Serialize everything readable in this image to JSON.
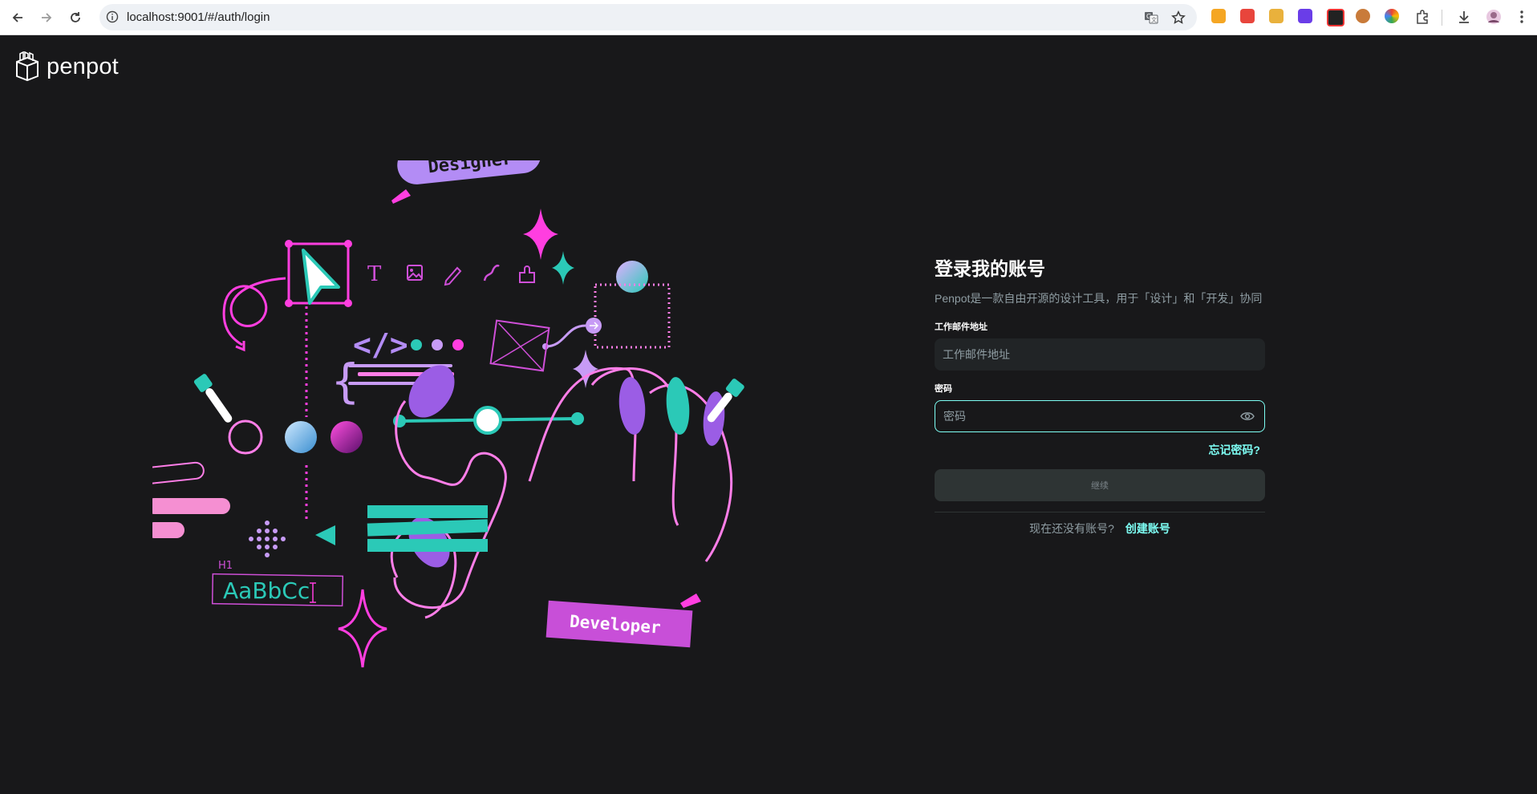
{
  "browser": {
    "url": "localhost:9001/#/auth/login",
    "icons": [
      "back-icon",
      "forward-icon",
      "reload-icon",
      "site-info-icon",
      "translate-icon",
      "bookmark-star-icon",
      "downloads-icon",
      "profile-avatar",
      "menu-dots-icon"
    ]
  },
  "app": {
    "logo_text": "penpot"
  },
  "illustration": {
    "designer_badge": "Designer",
    "developer_badge": "Developer",
    "type_sample": "AaBbCc",
    "heading_tag": "H1",
    "text_tool_glyph": "T",
    "code_glyph": "</>",
    "brace_glyph": "{"
  },
  "login": {
    "title": "登录我的账号",
    "subtitle": "Penpot是一款自由开源的设计工具，用于「设计」和「开发」协同",
    "email_label": "工作邮件地址",
    "email_placeholder": "工作邮件地址",
    "password_label": "密码",
    "password_placeholder": "密码",
    "forgot_password": "忘记密码?",
    "submit_label": "继续",
    "no_account_text": "现在还没有账号?",
    "create_account": "创建账号"
  },
  "colors": {
    "background": "#18181a",
    "accent": "#7efff5",
    "input_bg": "#212426",
    "button_bg": "#2e3434"
  }
}
